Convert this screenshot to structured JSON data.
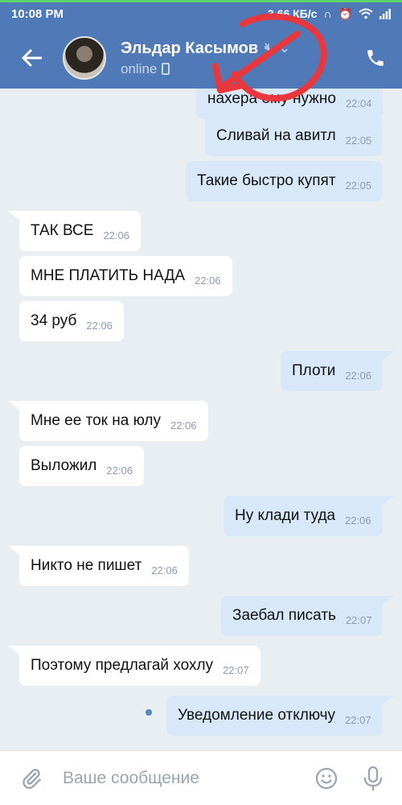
{
  "status_bar": {
    "time": "10:08 PM",
    "speed": "3,66 КБ/с"
  },
  "header": {
    "contact_name": "Эльдар Касымов",
    "status": "online"
  },
  "input": {
    "placeholder": "Ваше сообщение"
  },
  "messages": [
    {
      "dir": "out",
      "text": "нахера ему нужно",
      "time": "22:04",
      "tail": false
    },
    {
      "dir": "out",
      "text": "Сливай на авитл",
      "time": "22:05",
      "tail": false
    },
    {
      "dir": "out",
      "text": "Такие быстро купят",
      "time": "22:05",
      "tail": false
    },
    {
      "dir": "in",
      "text": "ТАК ВСЕ",
      "time": "22:06",
      "tail": true
    },
    {
      "dir": "in",
      "text": "МНЕ ПЛАТИТЬ НАДА",
      "time": "22:06",
      "tail": false
    },
    {
      "dir": "in",
      "text": "34 руб",
      "time": "22:06",
      "tail": false
    },
    {
      "dir": "out",
      "text": "Плоти",
      "time": "22:06",
      "tail": true
    },
    {
      "dir": "in",
      "text": "Мне ее ток на юлу",
      "time": "22:06",
      "tail": true
    },
    {
      "dir": "in",
      "text": "Выложил",
      "time": "22:06",
      "tail": false
    },
    {
      "dir": "out",
      "text": "Ну клади туда",
      "time": "22:06",
      "tail": true
    },
    {
      "dir": "in",
      "text": "Никто не пишет",
      "time": "22:06",
      "tail": true
    },
    {
      "dir": "out",
      "text": "Заебал писать",
      "time": "22:07",
      "tail": true
    },
    {
      "dir": "in",
      "text": "Поэтому предлагай хохлу",
      "time": "22:07",
      "tail": true
    },
    {
      "dir": "out",
      "text": "Уведомление отключу",
      "time": "22:07",
      "tail": true,
      "unread": true
    }
  ],
  "colors": {
    "header": "#4f7ab7",
    "incoming": "#ffffff",
    "outgoing": "#d9e8f9",
    "annotation": "#e8383d"
  }
}
